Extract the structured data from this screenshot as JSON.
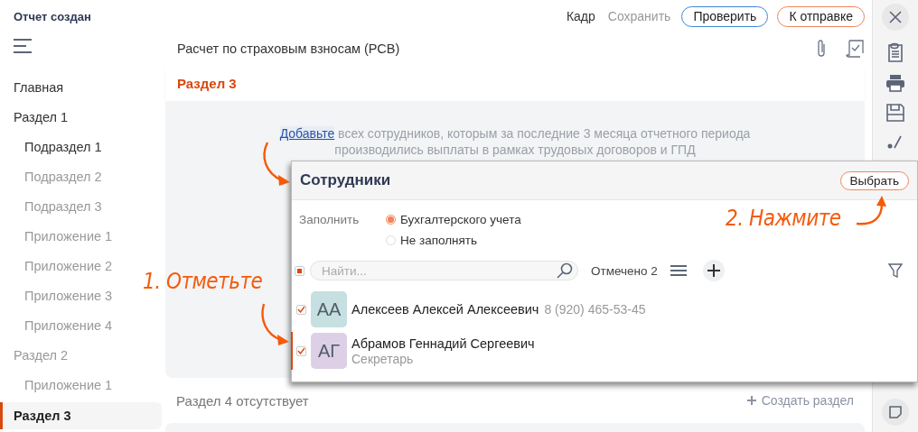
{
  "header": {
    "title": "Отчет создан",
    "actions": [
      {
        "label": "Кадр",
        "kind": "link",
        "disabled": false
      },
      {
        "label": "Сохранить",
        "kind": "link",
        "disabled": true
      },
      {
        "label": "Проверить",
        "kind": "outline",
        "color": "#3f86d6"
      },
      {
        "label": "К отправке",
        "kind": "outline",
        "color": "#f0865a"
      }
    ]
  },
  "sidebar": {
    "items": [
      {
        "label": "Главная",
        "filled": true,
        "selected": false
      },
      {
        "label": "Раздел 1",
        "filled": true,
        "selected": false,
        "children": [
          {
            "label": "Подраздел 1",
            "filled": true,
            "selected": false
          },
          {
            "label": "Подраздел 2",
            "filled": false,
            "selected": false
          },
          {
            "label": "Подраздел 3",
            "filled": false,
            "selected": false
          },
          {
            "label": "Приложение 1",
            "filled": false,
            "selected": false
          },
          {
            "label": "Приложение 2",
            "filled": false,
            "selected": false
          },
          {
            "label": "Приложение 3",
            "filled": false,
            "selected": false
          },
          {
            "label": "Приложение 4",
            "filled": false,
            "selected": false
          }
        ]
      },
      {
        "label": "Раздел 2",
        "filled": false,
        "selected": false,
        "children": [
          {
            "label": "Приложение 1",
            "filled": false,
            "selected": false
          }
        ]
      },
      {
        "label": "Раздел 3",
        "filled": true,
        "selected": true
      }
    ]
  },
  "document": {
    "title": "Расчет по страховым взносам (РСВ)",
    "section_title": "Раздел 3",
    "hint": {
      "link": "Добавьте",
      "lines": [
        "всех сотрудников, которым за последние 3 месяца отчетного периода",
        "производились выплаты в рамках трудовых договоров и ГПД"
      ]
    },
    "missing_section": "Раздел 4 отсутствует",
    "create_section": "Создать раздел"
  },
  "dialog": {
    "title": "Сотрудники",
    "select_button": "Выбрать",
    "fill_label": "Заполнить",
    "fill_options": [
      {
        "label": "Бухгалтерского учета",
        "selected": true
      },
      {
        "label": "Не заполнять",
        "selected": false
      }
    ],
    "select_all": {
      "checked": true
    },
    "search": {
      "placeholder": "Найти..."
    },
    "marked_count": "Отмечено 2",
    "employees": [
      {
        "initials": "АА",
        "name": "Алексеев Алексей Алексеевич",
        "detail": "8 (920) 465-53-45",
        "kind": "phone",
        "checked": true,
        "selected": false,
        "color": "#c6dfe0"
      },
      {
        "initials": "АГ",
        "name": "Абрамов Геннадий Сергеевич",
        "detail": "Секретарь",
        "kind": "position",
        "checked": true,
        "selected": true,
        "color": "#ddd0e6"
      }
    ]
  },
  "annotations": [
    {
      "text": "1. Отметьте"
    },
    {
      "text": "2. Нажмите"
    }
  ]
}
